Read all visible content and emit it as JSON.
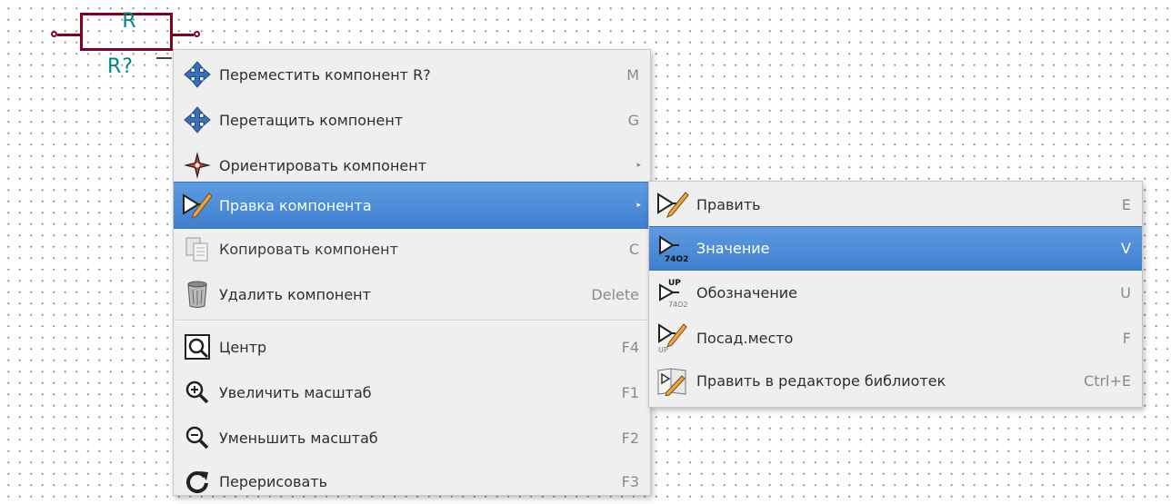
{
  "schematic": {
    "component_value": "R",
    "component_reference": "R?"
  },
  "context_menu": {
    "items": [
      {
        "label": "Переместить компонент R?",
        "shortcut": "M",
        "icon": "move-cross-icon"
      },
      {
        "label": "Перетащить компонент",
        "shortcut": "G",
        "icon": "drag-cross-icon"
      },
      {
        "label": "Ориентировать компонент",
        "shortcut": "",
        "icon": "orient-star-icon",
        "submenu": true
      },
      {
        "label": "Правка компонента",
        "shortcut": "",
        "icon": "edit-component-icon",
        "submenu": true,
        "selected": true
      },
      {
        "label": "Копировать компонент",
        "shortcut": "C",
        "icon": "copy-icon"
      },
      {
        "label": "Удалить компонент",
        "shortcut": "Delete",
        "icon": "trash-icon"
      },
      {
        "label": "Центр",
        "shortcut": "F4",
        "icon": "zoom-center-icon"
      },
      {
        "label": "Увеличить масштаб",
        "shortcut": "F1",
        "icon": "zoom-in-icon"
      },
      {
        "label": "Уменьшить масштаб",
        "shortcut": "F2",
        "icon": "zoom-out-icon"
      },
      {
        "label": "Перерисовать",
        "shortcut": "F3",
        "icon": "redraw-icon"
      }
    ],
    "submenu_arrow": "▸"
  },
  "edit_submenu": {
    "items": [
      {
        "label": "Править",
        "shortcut": "E",
        "icon": "edit-icon"
      },
      {
        "label": "Значение",
        "shortcut": "V",
        "icon": "value-icon",
        "selected": true
      },
      {
        "label": "Обозначение",
        "shortcut": "U",
        "icon": "reference-icon"
      },
      {
        "label": "Посад.место",
        "shortcut": "F",
        "icon": "footprint-icon"
      },
      {
        "label": "Править в редакторе библиотек",
        "shortcut": "Ctrl+E",
        "icon": "library-editor-icon"
      }
    ],
    "icon_text": {
      "chip_top": "UP",
      "chip_bottom": "74O2"
    }
  },
  "colors": {
    "selection": "#4a89d8",
    "component_outline": "#84001e",
    "component_text": "#008484"
  }
}
